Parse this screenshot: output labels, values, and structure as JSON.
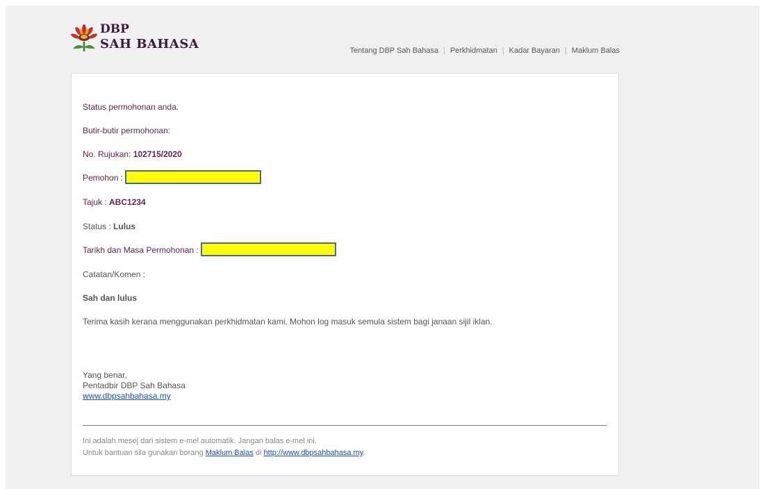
{
  "logo": {
    "line1": "DBP",
    "line2": "SAH BAHASA"
  },
  "nav": {
    "items": [
      "Tentang DBP Sah Bahasa",
      "Perkhidmatan",
      "Kadar Bayaran",
      "Maklum Balas"
    ],
    "separator": "|"
  },
  "email": {
    "intro": "Status permohonan anda.",
    "details_heading": "Butir-butir permohonan:",
    "ref_label": "No. Rujukan: ",
    "ref_value": "102715/2020",
    "applicant_label": "Pemohon : ",
    "title_label": "Tajuk : ",
    "title_value": "ABC1234",
    "status_label": "Status : ",
    "status_value": "Lulus",
    "datetime_label": "Tarikh dan Masa Permohonan : ",
    "notes_label": "Catatan/Komen :",
    "notes_value": "Sah dan lulus",
    "thanks": "Terima kasih kerana menggunakan perkhidmatan kami. Mohon log masuk semula sistem bagi janaan sijil iklan."
  },
  "signature": {
    "closing": "Yang benar,",
    "sender": "Pentadbir DBP Sah Bahasa",
    "website": "www.dbpsahbahasa.my"
  },
  "footer": {
    "notice": "Ini adalah mesej dari sistem e-mel automatik. Jangan balas e-mel ini.",
    "help_prefix": "Untuk bantuan sila gunakan borang ",
    "help_link": "Maklum Balas",
    "help_middle": " di ",
    "help_url": "http://www.dbpsahbahasa.my",
    "help_suffix": "."
  },
  "colors": {
    "redaction_fill": "#ffff00",
    "redaction_border": "#4a6a8f",
    "text_accent": "#5b2650",
    "link": "#1a4fb0"
  }
}
